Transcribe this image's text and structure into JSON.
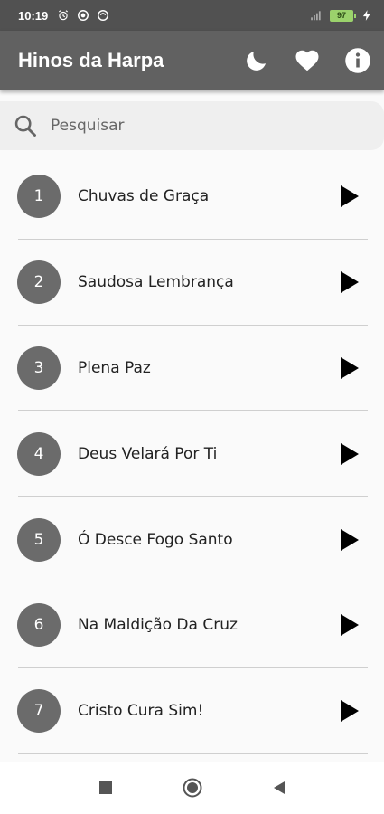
{
  "status_bar": {
    "time": "10:19",
    "battery": "97",
    "icons": [
      "alarm-icon",
      "vpn-icon",
      "sync-icon",
      "signal-icon",
      "battery-icon",
      "charging-icon"
    ]
  },
  "app_bar": {
    "title": "Hinos da Harpa",
    "actions": [
      "dark-mode-icon",
      "favorites-icon",
      "info-icon"
    ]
  },
  "search": {
    "placeholder": "Pesquisar"
  },
  "hymns": [
    {
      "number": "1",
      "title": "Chuvas de Graça"
    },
    {
      "number": "2",
      "title": "Saudosa Lembrança"
    },
    {
      "number": "3",
      "title": "Plena Paz"
    },
    {
      "number": "4",
      "title": "Deus Velará Por Ti"
    },
    {
      "number": "5",
      "title": "Ó Desce Fogo Santo"
    },
    {
      "number": "6",
      "title": "Na Maldição Da Cruz"
    },
    {
      "number": "7",
      "title": "Cristo Cura Sim!"
    }
  ],
  "colors": {
    "app_bar": "#616161",
    "status_bar": "#515151",
    "number_circle": "#6b6b6b"
  },
  "nav_bar": [
    "recents-icon",
    "home-icon",
    "back-icon"
  ]
}
